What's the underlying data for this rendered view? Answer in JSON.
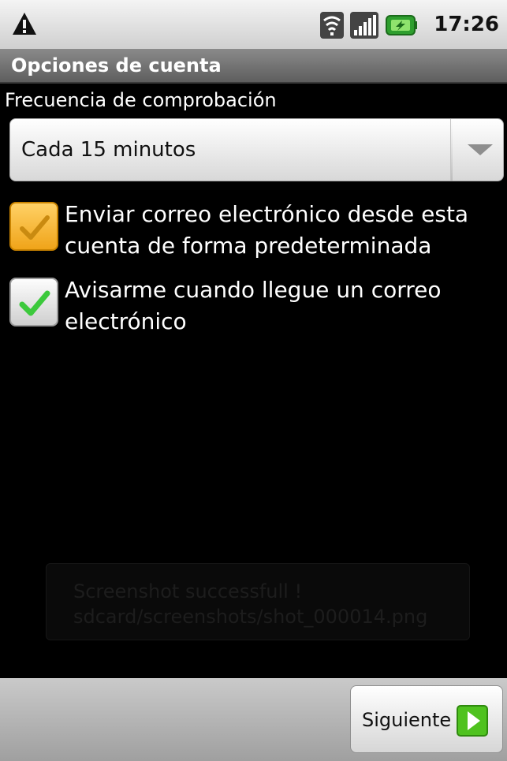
{
  "status_bar": {
    "time": "17:26",
    "icons": [
      "warning-icon",
      "wifi-icon",
      "signal-icon",
      "battery-charging-icon"
    ]
  },
  "title_bar": {
    "title": "Opciones de cuenta"
  },
  "frequency": {
    "label": "Frecuencia de comprobación",
    "selected": "Cada 15 minutos"
  },
  "options": [
    {
      "label_line1": "Enviar correo electrónico desde esta",
      "label_line2": "cuenta de forma predeterminada",
      "checked": true,
      "highlighted": true
    },
    {
      "label_line1": "Avisarme cuando llegue un correo",
      "label_line2": "electrónico",
      "checked": true,
      "highlighted": false
    }
  ],
  "toast": {
    "line1": "Screenshot successfull !",
    "line2": "sdcard/screenshots/shot_000014.png"
  },
  "bottom_bar": {
    "next_label": "Siguiente"
  },
  "colors": {
    "accent_orange": "#f0a419",
    "check_green": "#3cc93c",
    "next_arrow_green": "#4fc21f"
  }
}
